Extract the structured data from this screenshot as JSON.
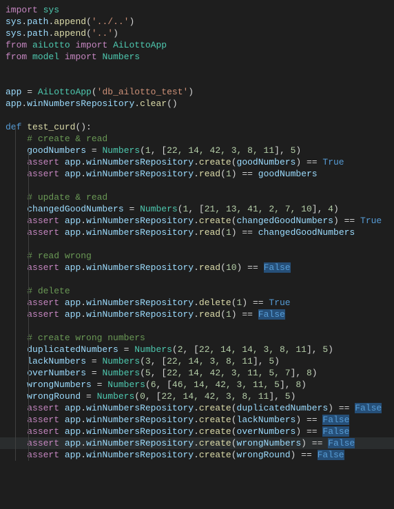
{
  "code": {
    "l1": {
      "kw": "import",
      "mod": "sys"
    },
    "l2": {
      "obj": "sys",
      "attr": "path",
      "method": "append",
      "arg": "'../..'"
    },
    "l3": {
      "obj": "sys",
      "attr": "path",
      "method": "append",
      "arg": "'..'"
    },
    "l4": {
      "kw1": "from",
      "mod": "aiLotto",
      "kw2": "import",
      "cls": "AiLottoApp"
    },
    "l5": {
      "kw1": "from",
      "mod": "model",
      "kw2": "import",
      "cls": "Numbers"
    },
    "l6": {
      "var": "app",
      "cls": "AiLottoApp",
      "arg": "'db_ailotto_test'"
    },
    "l7": {
      "obj": "app",
      "attr": "winNumbersRepository",
      "method": "clear"
    },
    "l8": {
      "kw": "def",
      "name": "test_curd"
    },
    "c1": "# create & read",
    "l9": {
      "var": "goodNumbers",
      "cls": "Numbers",
      "n1": "1",
      "arr": "22, 14, 42, 3, 8, 11",
      "n2": "5"
    },
    "l10": {
      "kw": "assert",
      "obj": "app",
      "attr": "winNumbersRepository",
      "method": "create",
      "arg": "goodNumbers",
      "eq": "True"
    },
    "l11": {
      "kw": "assert",
      "obj": "app",
      "attr": "winNumbersRepository",
      "method": "read",
      "arg": "1",
      "eq": "goodNumbers"
    },
    "c2": "# update & read",
    "l12": {
      "var": "changedGoodNumbers",
      "cls": "Numbers",
      "n1": "1",
      "arr": "21, 13, 41, 2, 7, 10",
      "n2": "4"
    },
    "l13": {
      "kw": "assert",
      "obj": "app",
      "attr": "winNumbersRepository",
      "method": "create",
      "arg": "changedGoodNumbers",
      "eq": "True"
    },
    "l14": {
      "kw": "assert",
      "obj": "app",
      "attr": "winNumbersRepository",
      "method": "read",
      "arg": "1",
      "eq": "changedGoodNumbers"
    },
    "c3": "# read wrong",
    "l15": {
      "kw": "assert",
      "obj": "app",
      "attr": "winNumbersRepository",
      "method": "read",
      "arg": "10",
      "eq": "False"
    },
    "c4": "# delete",
    "l16": {
      "kw": "assert",
      "obj": "app",
      "attr": "winNumbersRepository",
      "method": "delete",
      "arg": "1",
      "eq": "True"
    },
    "l17": {
      "kw": "assert",
      "obj": "app",
      "attr": "winNumbersRepository",
      "method": "read",
      "arg": "1",
      "eq": "False"
    },
    "c5": "# create wrong numbers",
    "l18": {
      "var": "duplicatedNumbers",
      "cls": "Numbers",
      "n1": "2",
      "arr": "22, 14, 14, 3, 8, 11",
      "n2": "5"
    },
    "l19": {
      "var": "lackNumbers",
      "cls": "Numbers",
      "n1": "3",
      "arr": "22, 14, 3, 8, 11",
      "n2": "5"
    },
    "l20": {
      "var": "overNumbers",
      "cls": "Numbers",
      "n1": "5",
      "arr": "22, 14, 42, 3, 11, 5, 7",
      "n2": "8"
    },
    "l21": {
      "var": "wrongNumbers",
      "cls": "Numbers",
      "n1": "6",
      "arr": "46, 14, 42, 3, 11, 5",
      "n2": "8"
    },
    "l22": {
      "var": "wrongRound",
      "cls": "Numbers",
      "n1": "0",
      "arr": "22, 14, 42, 3, 8, 11",
      "n2": "5"
    },
    "l23": {
      "kw": "assert",
      "obj": "app",
      "attr": "winNumbersRepository",
      "method": "create",
      "arg": "duplicatedNumbers",
      "eq": "False"
    },
    "l24": {
      "kw": "assert",
      "obj": "app",
      "attr": "winNumbersRepository",
      "method": "create",
      "arg": "lackNumbers",
      "eq": "False"
    },
    "l25": {
      "kw": "assert",
      "obj": "app",
      "attr": "winNumbersRepository",
      "method": "create",
      "arg": "overNumbers",
      "eq": "False"
    },
    "l26": {
      "kw": "assert",
      "obj": "app",
      "attr": "winNumbersRepository",
      "method": "create",
      "arg": "wrongNumbers",
      "eq": "False"
    },
    "l27": {
      "kw": "assert",
      "obj": "app",
      "attr": "winNumbersRepository",
      "method": "create",
      "arg": "wrongRound",
      "eq": "False"
    }
  }
}
